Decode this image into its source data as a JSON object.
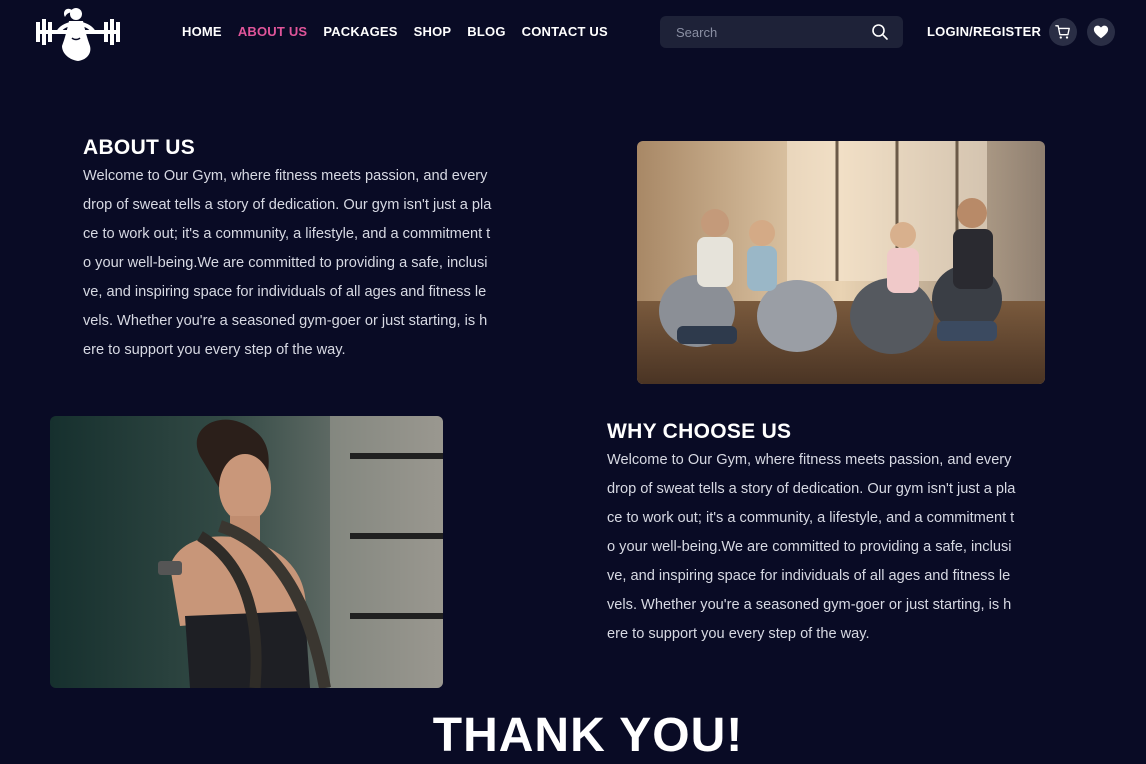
{
  "header": {
    "nav": [
      {
        "label": "HOME",
        "active": false
      },
      {
        "label": "ABOUT US",
        "active": true
      },
      {
        "label": "PACKAGES",
        "active": false
      },
      {
        "label": "SHOP",
        "active": false
      },
      {
        "label": "BLOG",
        "active": false
      },
      {
        "label": "CONTACT US",
        "active": false
      }
    ],
    "search": {
      "placeholder": "Search",
      "value": ""
    },
    "login_label": "LOGIN/REGISTER",
    "icons": [
      "logo-woman-dumbbell",
      "search-icon",
      "cart-icon",
      "heart-icon"
    ]
  },
  "about": {
    "heading": "ABOUT US",
    "text": "Welcome to Our Gym, where fitness meets passion, and every drop of sweat tells a story of dedication. Our gym isn't just a place to work out; it's a community, a lifestyle, and a commitment to your well-being.We are committed to providing a safe, inclusive, and inspiring space for individuals of all ages and fitness levels. Whether you're a seasoned gym-goer or just starting, is here to support you every step of the way."
  },
  "why": {
    "heading": "WHY CHOOSE US",
    "text": "Welcome to Our Gym, where fitness meets passion, and every drop of sweat tells a story of dedication. Our gym isn't just a place to work out; it's a community, a lifestyle, and a commitment to your well-being.We are committed to providing a safe, inclusive, and inspiring space for individuals of all ages and fitness levels. Whether you're a seasoned gym-goer or just starting, is here to support you every step of the way."
  },
  "thanks": "THANK YOU!",
  "colors": {
    "background": "#090b25",
    "accent": "#e0559a",
    "search_bg": "#1e2238",
    "icon_bg": "#2a2e45",
    "text": "#ffffff"
  }
}
